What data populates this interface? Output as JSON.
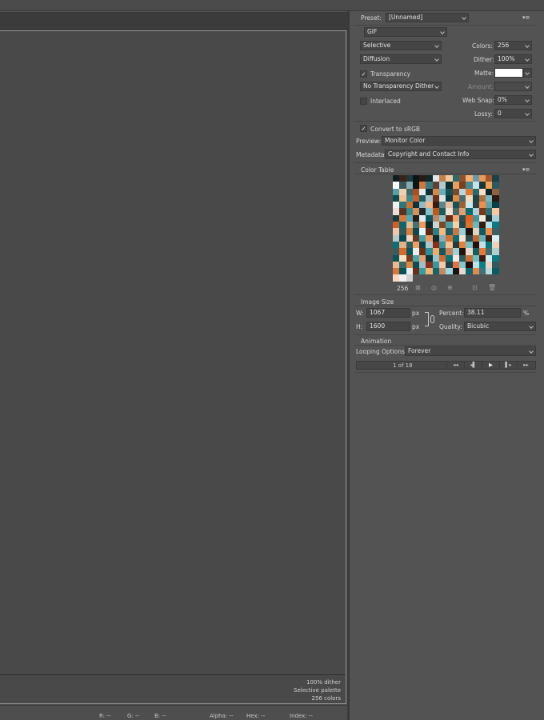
{
  "canvas": {
    "info_lines": [
      "100% dither",
      "Selective palette",
      "256 colors"
    ]
  },
  "status_bar": {
    "r": "R: --",
    "g": "G: --",
    "b": "B: --",
    "alpha": "Alpha: --",
    "hex": "Hex: --",
    "index": "Index: --"
  },
  "preset": {
    "label": "Preset:",
    "value": "[Unnamed]",
    "menu_icon": "▾≡"
  },
  "settings": {
    "format": "GIF",
    "reduction": "Selective",
    "dither_algorithm": "Diffusion",
    "transparency_label": "Transparency",
    "transparency_checked": true,
    "transparency_dither": "No Transparency Dither",
    "interlaced_label": "Interlaced",
    "interlaced_checked": false,
    "colors_label": "Colors:",
    "colors_value": "256",
    "dither_label": "Dither:",
    "dither_value": "100%",
    "matte_label": "Matte:",
    "matte_color": "#ffffff",
    "amount_label": "Amount:",
    "websnap_label": "Web Snap:",
    "websnap_value": "0%",
    "lossy_label": "Lossy:",
    "lossy_value": "0",
    "convert_srgb_label": "Convert to sRGB",
    "convert_srgb_checked": true,
    "preview_label": "Preview:",
    "preview_value": "Monitor Color",
    "metadata_label": "Metadata:",
    "metadata_value": "Copyright and Contact Info"
  },
  "color_table": {
    "title": "Color Table",
    "count": "256",
    "swatch_colors": [
      "#0e1f22",
      "#3a2417",
      "#1c3a3f",
      "#0a1414",
      "#2b1a12",
      "#11292b",
      "#e0e6ea",
      "#c08050",
      "#f0c8a0",
      "#2a6b70",
      "#905030",
      "#f4b070",
      "#6a9aa8",
      "#e89a5a",
      "#a05828",
      "#1a4048",
      "#f8f8f8",
      "#38585a",
      "#8aa8b0",
      "#081818",
      "#d07840",
      "#3a7a80",
      "#604030",
      "#b0c8d0",
      "#0a2e30",
      "#e8a060",
      "#7a4020",
      "#4a8890",
      "#c8e0e8",
      "#183838",
      "#f0a050",
      "#2a5a60",
      "#58a0a8",
      "#f0d0b0",
      "#406868",
      "#a85020",
      "#e0f0f0",
      "#103034",
      "#d88848",
      "#68b0b8",
      "#1a5058",
      "#804828",
      "#b8d8e0",
      "#e07830",
      "#286870",
      "#f8e0c8",
      "#0c2426",
      "#906040",
      "#084c54",
      "#f4c090",
      "#3a8890",
      "#c86028",
      "#205c64",
      "#a8c0c8",
      "#6a3018",
      "#d8e8e8",
      "#0a3a40",
      "#e88840",
      "#4a6e70",
      "#f8d8b8",
      "#18484c",
      "#b07040",
      "#78b8c0",
      "#2c1810",
      "#f8f0e8",
      "#28787e",
      "#d07030",
      "#0e3438",
      "#98b8c0",
      "#f0b888",
      "#3a1c10",
      "#58888c",
      "#e8c0a0",
      "#10555c",
      "#a06030",
      "#c8e8ee",
      "#2a4446",
      "#f09048",
      "#68a0a8",
      "#084048",
      "#e8e0d8",
      "#5a3420",
      "#38888e",
      "#d89058",
      "#1c2c2c",
      "#88c0c8",
      "#c05818",
      "#185c62",
      "#f0e0d0",
      "#486868",
      "#e0a070",
      "#0a6a72",
      "#b0d0d8",
      "#783818",
      "#2e6e74",
      "#f8c8a0",
      "#143c40",
      "#d8783c",
      "#58a8b0",
      "#281c14",
      "#e0ecee",
      "#0c5a62",
      "#c08868",
      "#90c0c8",
      "#6a2c14",
      "#f0a878",
      "#2a5254",
      "#e86020",
      "#40969c",
      "#f8e8d8",
      "#1a3032",
      "#a8d0d8",
      "#d06028",
      "#086870",
      "#e8b890",
      "#3c7478",
      "#f09858",
      "#0e2a2c",
      "#c8d8d8",
      "#80481c",
      "#48a0a8",
      "#f8d0a8",
      "#204a4e",
      "#e07028",
      "#68b8c0",
      "#381a0c",
      "#b8e0e8",
      "#0c7880",
      "#f0c8a8",
      "#305a5c",
      "#d88040",
      "#0a4a50",
      "#e8f4f8",
      "#5a2810",
      "#2a8088",
      "#f8b880",
      "#186068",
      "#c87848",
      "#98d0d8",
      "#1a1410",
      "#e8d0c0",
      "#0a5c64",
      "#f08848",
      "#3a6062",
      "#b8c8c8",
      "#084850",
      "#f0d8c0",
      "#6a3820",
      "#40a0a8",
      "#e89860",
      "#102c2e",
      "#88b0b8",
      "#d87030",
      "#0c6c74",
      "#f8e0d0",
      "#284c50",
      "#c06830",
      "#60b0b8",
      "#3c1e10",
      "#d8f0f4",
      "#0a7078",
      "#e8b080",
      "#2e5e62",
      "#f0a060",
      "#144048",
      "#a8c8d0",
      "#902c10",
      "#38909a",
      "#f8c090",
      "#1c3e42",
      "#e88038",
      "#78c0c8",
      "#281008",
      "#c8e0e4",
      "#08787e",
      "#f0d0b8",
      "#345e60",
      "#d86828",
      "#0a545c",
      "#e8f0f0",
      "#6c2e14",
      "#289098",
      "#f8a868",
      "#14585e",
      "#c88058",
      "#a0d0d8",
      "#201410",
      "#f0d8c8",
      "#0c6068",
      "#e87838",
      "#406c70",
      "#b0d0d0",
      "#08545a",
      "#f8e0c0",
      "#7a3c1c",
      "#48a8b0",
      "#e8a070",
      "#0e3436",
      "#90c8d0",
      "#d06830",
      "#0a747c",
      "#f8e8e0",
      "#2c5a5e",
      "#c87038",
      "#68c0c8",
      "#401c0c",
      "#d0ecf0",
      "#087c84",
      "#f0b890",
      "#386a6e",
      "#e08840",
      "#0c4c54",
      "#a0c0c8",
      "#88301a",
      "#3898a0",
      "#f8c8a8",
      "#1c4448",
      "#e87040",
      "#80c8d0",
      "#240c08",
      "#c0e0e8",
      "#08808a",
      "#f0d0c0",
      "#325a5c",
      "#d87838",
      "#0a5058",
      "#e0f0f4",
      "#702c14",
      "#30a0a8",
      "#f8b070",
      "#10686e",
      "#c88860",
      "#98d8e0",
      "#1c1210",
      "#e8d8d0",
      "#0e6870",
      "#e88848",
      "#3e7478",
      "#b8d8d8",
      "#0a5c60",
      "#f8d8c0",
      "#f0f0f0",
      "#d0d0d0"
    ],
    "tools": [
      "⊠",
      "◎",
      "⊕",
      "⊡",
      "🗑"
    ]
  },
  "image_size": {
    "title": "Image Size",
    "w_label": "W:",
    "w_value": "1067",
    "h_label": "H:",
    "h_value": "1600",
    "unit": "px",
    "percent_label": "Percent:",
    "percent_value": "38.11",
    "percent_unit": "%",
    "quality_label": "Quality:",
    "quality_value": "Bicubic"
  },
  "animation": {
    "title": "Animation",
    "looping_label": "Looping Options:",
    "looping_value": "Forever",
    "frame_counter": "1 of 18",
    "controls": [
      "◂◂",
      "◂▌",
      "▶",
      "▌▸",
      "▸▸"
    ]
  }
}
